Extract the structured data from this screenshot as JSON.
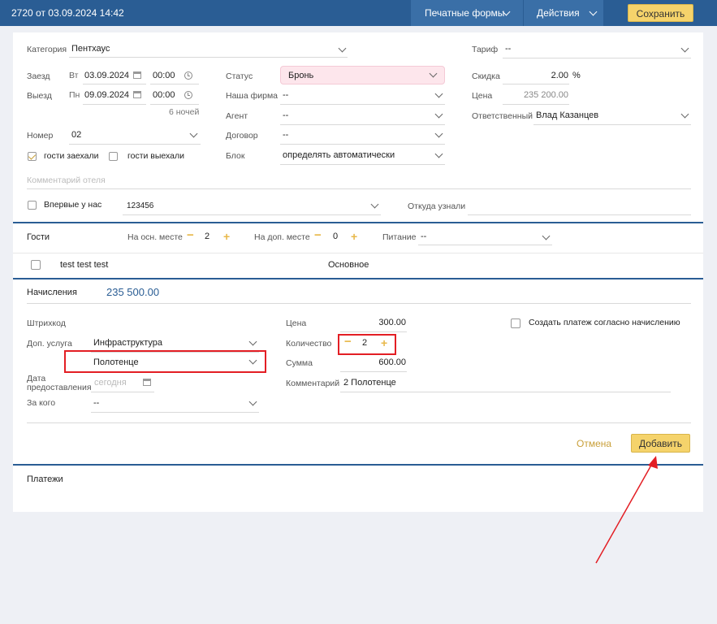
{
  "header": {
    "title": "2720 от 03.09.2024 14:42",
    "print_forms": "Печатные формы",
    "actions": "Действия",
    "save": "Сохранить"
  },
  "booking": {
    "category_label": "Категория",
    "category_value": "Пентхаус",
    "checkin_label": "Заезд",
    "checkin_day": "Вт",
    "checkin_date": "03.09.2024",
    "checkin_time": "00:00",
    "checkout_label": "Выезд",
    "checkout_day": "Пн",
    "checkout_date": "09.09.2024",
    "checkout_time": "00:00",
    "nights": "6 ночей",
    "room_label": "Номер",
    "room_value": "02",
    "guests_in": "гости заехали",
    "guests_out": "гости выехали",
    "status_label": "Статус",
    "status_value": "Бронь",
    "firm_label": "Наша фирма",
    "firm_value": "--",
    "agent_label": "Агент",
    "agent_value": "--",
    "contract_label": "Договор",
    "contract_value": "--",
    "block_label": "Блок",
    "block_value": "определять автоматически",
    "tariff_label": "Тариф",
    "tariff_value": "--",
    "discount_label": "Скидка",
    "discount_value": "2.00",
    "discount_unit": "%",
    "price_label": "Цена",
    "price_value": "235 200.00",
    "responsible_label": "Ответственный",
    "responsible_value": "Влад Казанцев",
    "comment_placeholder": "Комментарий отеля",
    "first_time_label": "Впервые у нас",
    "first_time_value": "123456",
    "source_label": "Откуда узнали"
  },
  "guests": {
    "title": "Гости",
    "main_place_label": "На осн. месте",
    "main_place_value": "2",
    "extra_place_label": "На доп. месте",
    "extra_place_value": "0",
    "food_label": "Питание",
    "food_value": "--",
    "row_name": "test test test",
    "row_type": "Основное"
  },
  "charges": {
    "title": "Начисления",
    "total": "235 500.00",
    "barcode_label": "Штрихкод",
    "service_label": "Доп. услуга",
    "service_value": "Инфраструктура",
    "subservice_value": "Полотенце",
    "date_label_1": "Дата",
    "date_label_2": "предоставления",
    "date_placeholder": "сегодня",
    "for_whom_label": "За кого",
    "for_whom_value": "--",
    "price_label": "Цена",
    "price_value": "300.00",
    "qty_label": "Количество",
    "qty_value": "2",
    "sum_label": "Сумма",
    "sum_value": "600.00",
    "comment_label": "Комментарий",
    "comment_value": "2 Полотенце",
    "create_payment_label": "Создать платеж согласно начислению",
    "cancel": "Отмена",
    "add": "Добавить"
  },
  "payments": {
    "title": "Платежи"
  }
}
